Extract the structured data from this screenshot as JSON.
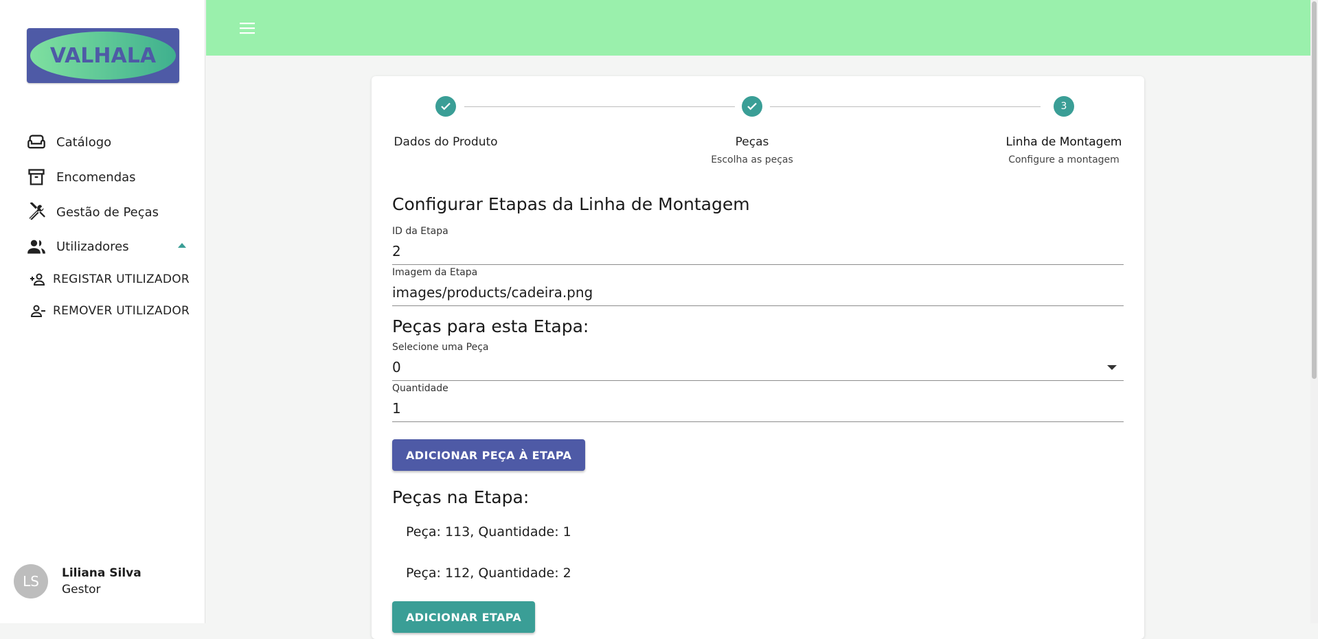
{
  "brand": {
    "logo_text": "VALHALA"
  },
  "sidebar": {
    "items": [
      {
        "label": "Catálogo",
        "icon": "sofa-icon"
      },
      {
        "label": "Encomendas",
        "icon": "archive-box-icon"
      },
      {
        "label": "Gestão de Peças",
        "icon": "tools-icon"
      },
      {
        "label": "Utilizadores",
        "icon": "users-icon",
        "expanded": true
      }
    ],
    "subitems": [
      {
        "label": "REGISTAR UTILIZADOR",
        "icon": "person-add-icon"
      },
      {
        "label": "REMOVER UTILIZADOR",
        "icon": "person-remove-icon"
      }
    ]
  },
  "user": {
    "initials": "LS",
    "name": "Liliana Silva",
    "role": "Gestor"
  },
  "stepper": {
    "steps": [
      {
        "label": "Dados do Produto",
        "subtitle": "",
        "state": "done"
      },
      {
        "label": "Peças",
        "subtitle": "Escolha as peças",
        "state": "done"
      },
      {
        "label": "Linha de Montagem",
        "subtitle": "Configure a montagem",
        "state": "active",
        "number": "3"
      }
    ]
  },
  "form": {
    "title": "Configurar Etapas da Linha de Montagem",
    "stage_id": {
      "label": "ID da Etapa",
      "value": "2"
    },
    "stage_image": {
      "label": "Imagem da Etapa",
      "value": "images/products/cadeira.png"
    },
    "parts_heading": "Peças para esta Etapa:",
    "part_select": {
      "label": "Selecione uma Peça",
      "value": "0"
    },
    "quantity": {
      "label": "Quantidade",
      "value": "1"
    },
    "add_part_button": "ADICIONAR PEÇA À ETAPA",
    "parts_in_stage_heading": "Peças na Etapa:",
    "parts_in_stage": [
      "Peça: 113, Quantidade: 1",
      "Peça: 112, Quantidade: 2"
    ],
    "add_stage_button": "ADICIONAR ETAPA"
  },
  "colors": {
    "topbar": "#9af0ac",
    "primary": "#4e5aa6",
    "accent": "#3a9e96"
  }
}
